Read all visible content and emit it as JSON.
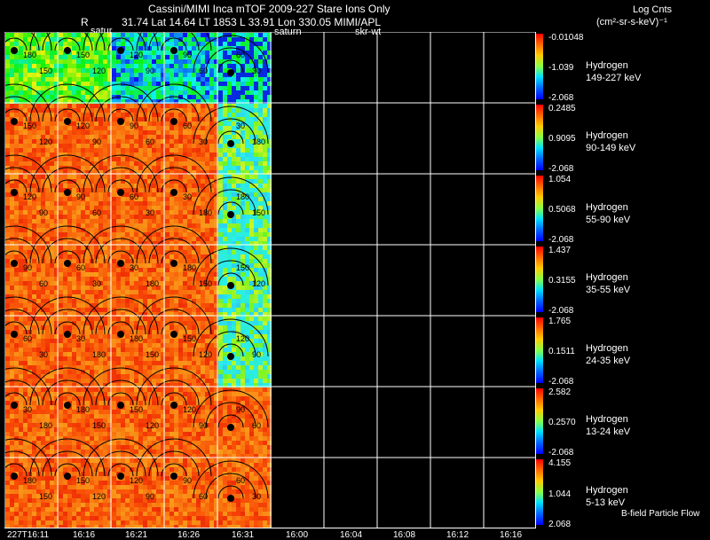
{
  "header": {
    "line1": "Cassini/MIMI Inca mTOF  2009-227   Stare    Ions Only",
    "r_label": "R",
    "line2": "31.74 Lat 14.64 LT 1853 L        33.91 Lon        330.05  MIMI/APL",
    "saturn1": "satur",
    "saturn2": "saturn",
    "skr": "skr-wt",
    "units_title": "Log Cnts",
    "units": "(cm²-sr-s-keV)⁻¹"
  },
  "chart_data": {
    "type": "heatmap",
    "title": "Cassini/MIMI Inca mTOF  2009-227   Stare    Ions Only",
    "x_tick_labels": [
      "227T16:11",
      "16:16",
      "16:21",
      "16:26",
      "16:31",
      "16:00",
      "16:04",
      "16:08",
      "16:12",
      "16:16"
    ],
    "images_per_row": 5,
    "empty_columns": 5,
    "contour_labels": [
      "180",
      "150",
      "120",
      "90",
      "60",
      "30"
    ],
    "footer_note": "B-field Particle Flow",
    "panels": [
      {
        "species": "Hydrogen",
        "energy": "149-227 keV",
        "cmax": "-0.01048",
        "cmid": "-1.039",
        "cmin": "-2.068"
      },
      {
        "species": "Hydrogen",
        "energy": "90-149 keV",
        "cmax": "0.2485",
        "cmid": "0.9095",
        "cmin": "-2.068"
      },
      {
        "species": "Hydrogen",
        "energy": "55-90 keV",
        "cmax": "1.054",
        "cmid": "0.5068",
        "cmin": "-2.068"
      },
      {
        "species": "Hydrogen",
        "energy": "35-55 keV",
        "cmax": "1.437",
        "cmid": "0.3155",
        "cmin": "-2.068"
      },
      {
        "species": "Hydrogen",
        "energy": "24-35 keV",
        "cmax": "1.765",
        "cmid": "0.1511",
        "cmin": "-2.068"
      },
      {
        "species": "Hydrogen",
        "energy": "13-24 keV",
        "cmax": "2.582",
        "cmid": "0.2570",
        "cmin": "-2.068"
      },
      {
        "species": "Hydrogen",
        "energy": "5-13 keV",
        "cmax": "4.155",
        "cmid": "1.044",
        "cmin": "2.068"
      }
    ]
  },
  "colors": {
    "hot": "#ff3300",
    "warm": "#ff8800",
    "cool": "#00ccff",
    "cold": "#0000ff",
    "grid": "#ffffff"
  }
}
